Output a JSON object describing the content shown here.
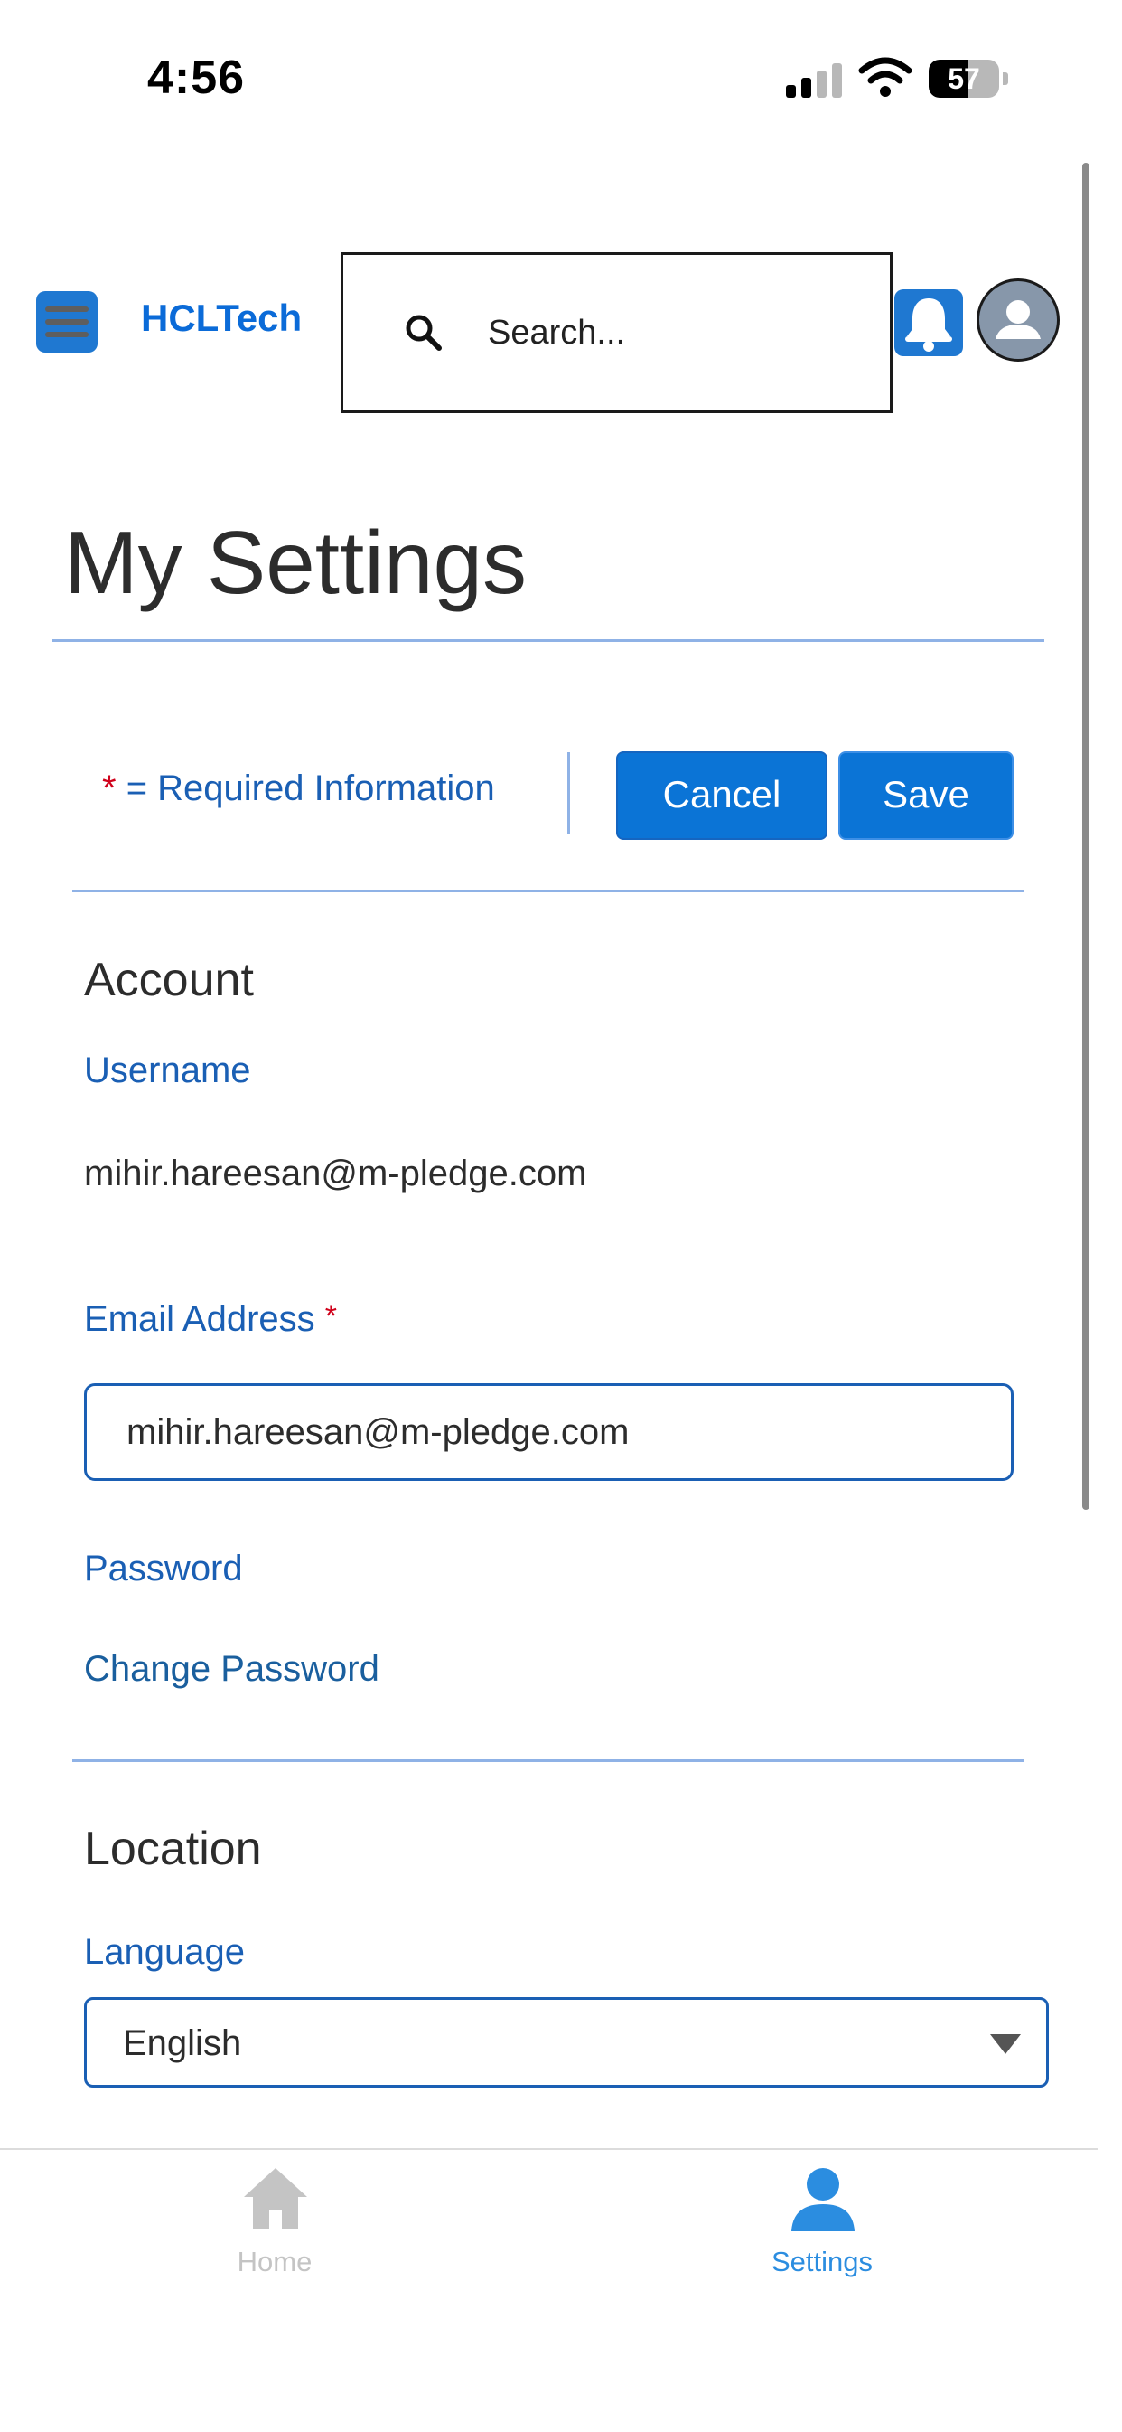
{
  "status_bar": {
    "time": "4:56",
    "battery": "57",
    "battery_fraction": 0.57
  },
  "header": {
    "logo": "HCLTech",
    "menu_icon": "hamburger-menu-icon",
    "search": {
      "placeholder": "Search...",
      "value": "",
      "icon": "search-icon"
    },
    "notification_icon": "bell-icon",
    "avatar_icon": "user-avatar-icon",
    "accent_color": "#1f78d1"
  },
  "page": {
    "title": "My Settings"
  },
  "actions": {
    "required_star": "*",
    "required_text": " = Required Information",
    "cancel_label": "Cancel",
    "save_label": "Save"
  },
  "account": {
    "heading": "Account",
    "username_label": "Username",
    "username_value": "mihir.hareesan@m-pledge.com",
    "email_label": "Email Address",
    "email_required": "*",
    "email_value": "mihir.hareesan@m-pledge.com",
    "password_label": "Password",
    "change_password_link": "Change Password"
  },
  "location": {
    "heading": "Location",
    "language_label": "Language",
    "language_value": "English"
  },
  "bottom_nav": {
    "items": [
      {
        "label": "Home",
        "icon": "home-icon",
        "active": false,
        "color": "#c4c4c4"
      },
      {
        "label": "Settings",
        "icon": "user-icon",
        "active": true,
        "color": "#2b8de0"
      }
    ]
  },
  "colors": {
    "primary_button": "#0b74d6",
    "link_blue": "#1a5fb4",
    "required_red": "#d0021b",
    "divider": "#8fb2e6"
  }
}
